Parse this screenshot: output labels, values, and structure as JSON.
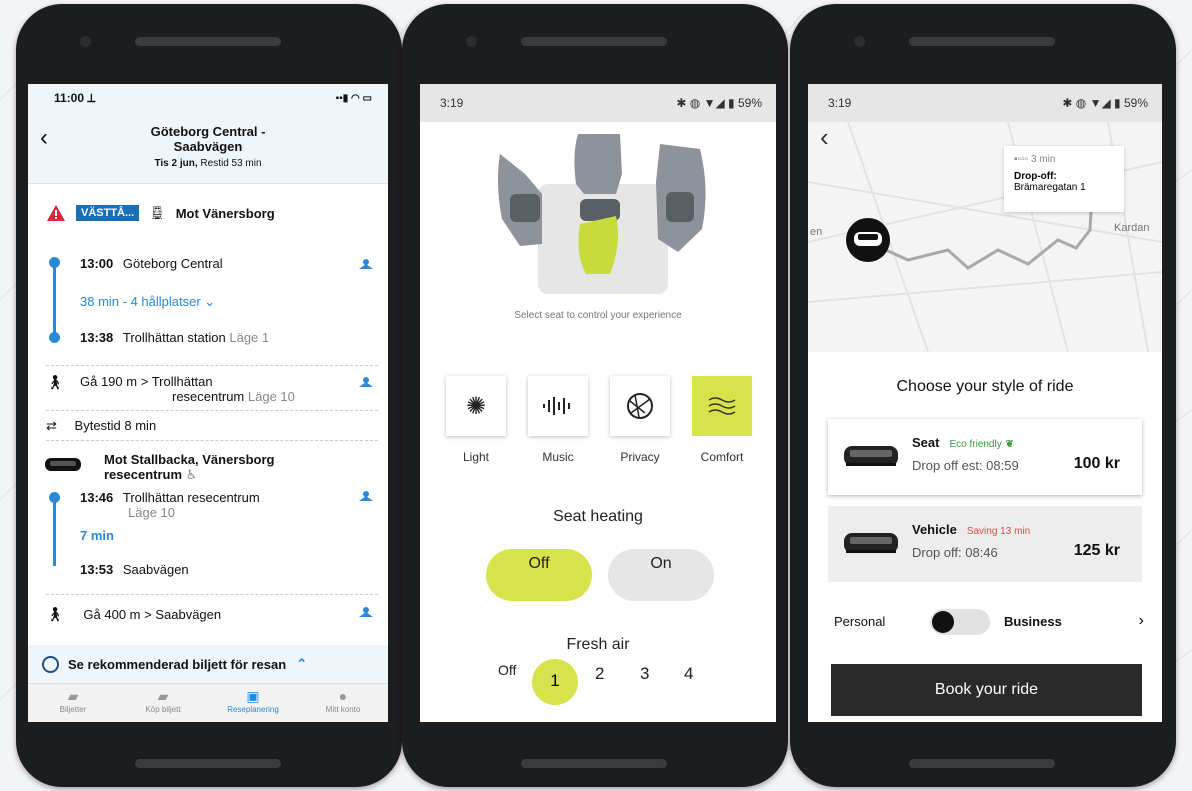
{
  "phone1": {
    "status": {
      "time": "11:00 ⟂"
    },
    "header": {
      "title_line1": "Göteborg Central -",
      "title_line2": "Saabvägen",
      "date": "Tis 2 jun,",
      "duration": "Restid 53 min"
    },
    "alert": {
      "badge": "VÄSTTÅ...",
      "direction": "Mot Vänersborg"
    },
    "leg1": {
      "dep_time": "13:00",
      "dep_stop": "Göteborg Central",
      "stops_summary": "38 min - 4 hållplatser",
      "arr_time": "13:38",
      "arr_stop": "Trollhättan station",
      "arr_platform": "Läge 1"
    },
    "walk1": {
      "text": "Gå 190 m",
      "dest_line1": "Trollhättan",
      "dest_line2": "resecentrum",
      "platform": "Läge 10"
    },
    "transfer": "Bytestid 8 min",
    "leg2": {
      "direction_line1": "Mot Stallbacka, Vänersborg",
      "direction_line2": "resecentrum",
      "dep_time": "13:46",
      "dep_stop": "Trollhättan resecentrum",
      "dep_platform": "Läge 10",
      "duration": "7 min",
      "arr_time": "13:53",
      "arr_stop": "Saabvägen"
    },
    "walk2": {
      "text": "Gå 400 m",
      "dest": "Saabvägen"
    },
    "recommend": "Se rekommenderad biljett för resan",
    "tabs": [
      {
        "label": "Biljetter"
      },
      {
        "label": "Köp biljett"
      },
      {
        "label": "Reseplanering"
      },
      {
        "label": "Mitt konto"
      }
    ]
  },
  "phone2": {
    "status": {
      "time": "3:19",
      "battery": "59%"
    },
    "caption": "Select seat to control your experience",
    "options": [
      {
        "label": "Light",
        "icon": "sun-icon"
      },
      {
        "label": "Music",
        "icon": "waveform-icon"
      },
      {
        "label": "Privacy",
        "icon": "globe-icon"
      },
      {
        "label": "Comfort",
        "icon": "waves-icon",
        "selected": true
      }
    ],
    "seat_heating": {
      "title": "Seat heating",
      "off": "Off",
      "on": "On",
      "value": "Off"
    },
    "fresh_air": {
      "title": "Fresh air",
      "off_label": "Off",
      "levels": [
        "1",
        "2",
        "3",
        "4"
      ],
      "selected": "1"
    },
    "accent": "#d6e34a"
  },
  "phone3": {
    "status": {
      "time": "3:19",
      "battery": "59%"
    },
    "map": {
      "callout_eta": "3 min",
      "callout_title": "Drop-off:",
      "callout_address": "Brämaregatan 1",
      "street_left": "en",
      "street_right": "Kardan"
    },
    "heading": "Choose your style of ride",
    "options": [
      {
        "name": "Seat",
        "tag": "Eco friendly",
        "tag_color": "#3a9a3a",
        "sub": "Drop off est: 08:59",
        "price": "100 kr"
      },
      {
        "name": "Vehicle",
        "tag": "Saving 13 min",
        "tag_color": "#e04848",
        "sub": "Drop off: 08:46",
        "price": "125 kr"
      }
    ],
    "toggle": {
      "left": "Personal",
      "right": "Business",
      "chevron": "›"
    },
    "book_label": "Book your ride"
  }
}
